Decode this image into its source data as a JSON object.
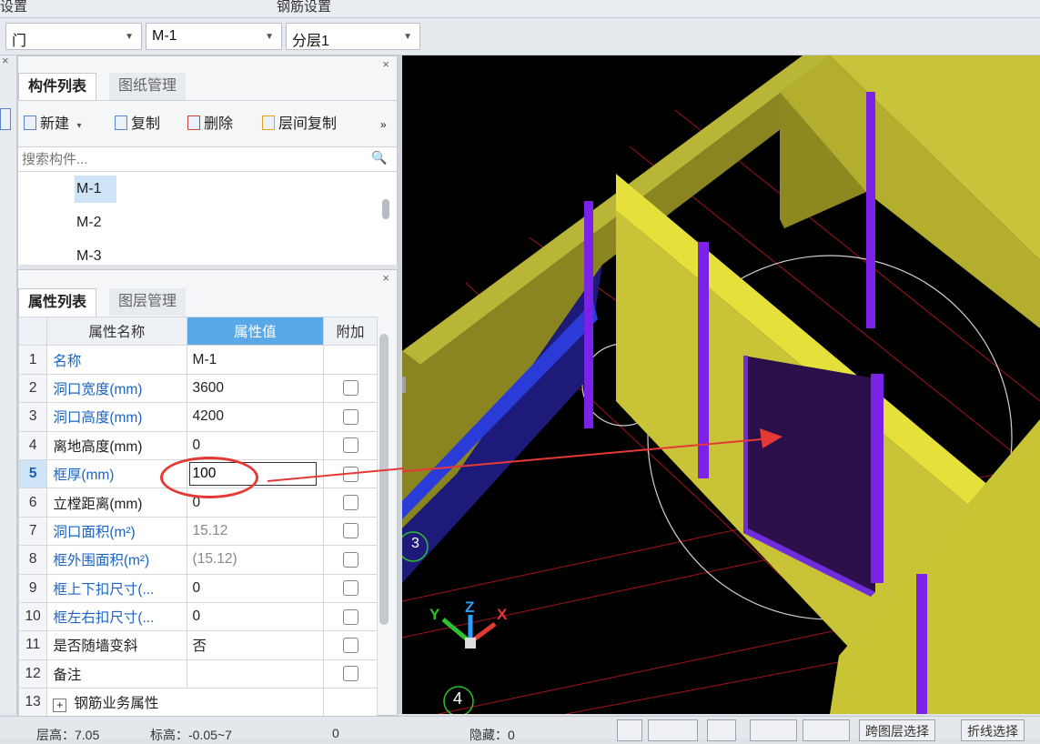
{
  "top_strip": {
    "left_label": "设置",
    "center_label": "钢筋设置"
  },
  "selectors": [
    {
      "value": "门"
    },
    {
      "value": "M-1"
    },
    {
      "value": "分层1"
    }
  ],
  "component_panel": {
    "tabs": [
      "构件列表",
      "图纸管理"
    ],
    "toolbar": {
      "new": "新建",
      "copy": "复制",
      "delete": "删除",
      "floor_copy": "层间复制",
      "more": "»"
    },
    "search_placeholder": "搜索构件...",
    "items": [
      "M-1",
      "M-2",
      "M-3"
    ],
    "selected_item": "M-1"
  },
  "property_panel": {
    "tabs": [
      "属性列表",
      "图层管理"
    ],
    "headers": {
      "name": "属性名称",
      "value": "属性值",
      "extra": "附加"
    },
    "rows": [
      {
        "idx": "1",
        "name": "名称",
        "value": "M-1"
      },
      {
        "idx": "2",
        "name": "洞口宽度(mm)",
        "value": "3600"
      },
      {
        "idx": "3",
        "name": "洞口高度(mm)",
        "value": "4200"
      },
      {
        "idx": "4",
        "name": "离地高度(mm)",
        "value": "0"
      },
      {
        "idx": "5",
        "name": "框厚(mm)",
        "value": "100"
      },
      {
        "idx": "6",
        "name": "立樘距离(mm)",
        "value": "0"
      },
      {
        "idx": "7",
        "name": "洞口面积(m²)",
        "value": "15.12"
      },
      {
        "idx": "8",
        "name": "框外围面积(m²)",
        "value": "(15.12)"
      },
      {
        "idx": "9",
        "name": "框上下扣尺寸(...",
        "value": "0"
      },
      {
        "idx": "10",
        "name": "框左右扣尺寸(...",
        "value": "0"
      },
      {
        "idx": "11",
        "name": "是否随墙变斜",
        "value": "否"
      },
      {
        "idx": "12",
        "name": "备注",
        "value": ""
      },
      {
        "idx": "13",
        "name": "钢筋业务属性",
        "value": ""
      }
    ],
    "row13_toggle": "+"
  },
  "viewport": {
    "axis_labels": {
      "x": "X",
      "y": "Y",
      "z": "Z"
    },
    "grid_marker": "4",
    "grid_marker_partial": "3"
  },
  "status_bar": {
    "floor_height": "层高：7.05",
    "elevation": "标高：-0.05~7",
    "zero": "0",
    "hidden": "隐藏：0",
    "layer_select": "跨图层选择",
    "polyline_select": "折线选择"
  },
  "colors": {
    "accent_blue": "#5aa9e6",
    "annotation_red": "#e53935",
    "wall_yellow": "#c8c43a",
    "rebar_purple": "#7a22e8",
    "viewport_bg": "#000000"
  }
}
